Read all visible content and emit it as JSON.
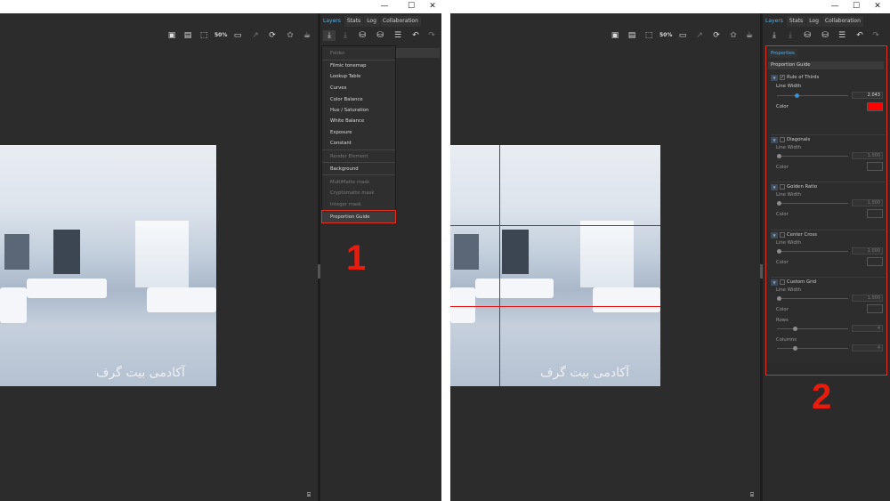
{
  "colors": {
    "accent": "#5aaee6",
    "highlight": "#e0301e",
    "guide_line": "#e01010",
    "swatch_red": "#ff0000"
  },
  "window_controls": [
    "—",
    "☐",
    "✕"
  ],
  "tabs": [
    "Layers",
    "Stats",
    "Log",
    "Collaboration"
  ],
  "zoom_label": "50%",
  "watermark": "آکادمی بیت گرف",
  "dropdown": {
    "items": [
      {
        "label": "Folder",
        "dim": true
      },
      {
        "label": "Filmic tonemap"
      },
      {
        "label": "Lookup Table"
      },
      {
        "label": "Curves"
      },
      {
        "label": "Color Balance"
      },
      {
        "label": "Hue / Saturation"
      },
      {
        "label": "White Balance"
      },
      {
        "label": "Exposure"
      },
      {
        "label": "Constant"
      },
      {
        "label": "Render Element",
        "dim": true
      },
      {
        "label": "Background"
      },
      {
        "label": "MultiMatte mask",
        "dim": true
      },
      {
        "label": "Cryptomatte mask",
        "dim": true
      },
      {
        "label": "Integer mask",
        "dim": true
      },
      {
        "label": "Proportion Guide",
        "selected": true
      }
    ]
  },
  "step_labels": [
    "1",
    "2"
  ],
  "properties": {
    "title": "Properties",
    "layer_name": "Proportion Guide",
    "line_width_label": "Line Width",
    "color_label": "Color",
    "rows_label": "Rows",
    "columns_label": "Columns",
    "groups": [
      {
        "name": "Rule of Thirds",
        "checked": true,
        "line_width": "2.043",
        "color": "#ff0000"
      },
      {
        "name": "Diagonals",
        "checked": false,
        "line_width": "1.000"
      },
      {
        "name": "Golden Ratio",
        "checked": false,
        "line_width": "1.000"
      },
      {
        "name": "Center Cross",
        "checked": false,
        "line_width": "1.000"
      },
      {
        "name": "Custom Grid",
        "checked": false,
        "line_width": "1.000",
        "rows": "4",
        "columns": "4"
      }
    ]
  }
}
